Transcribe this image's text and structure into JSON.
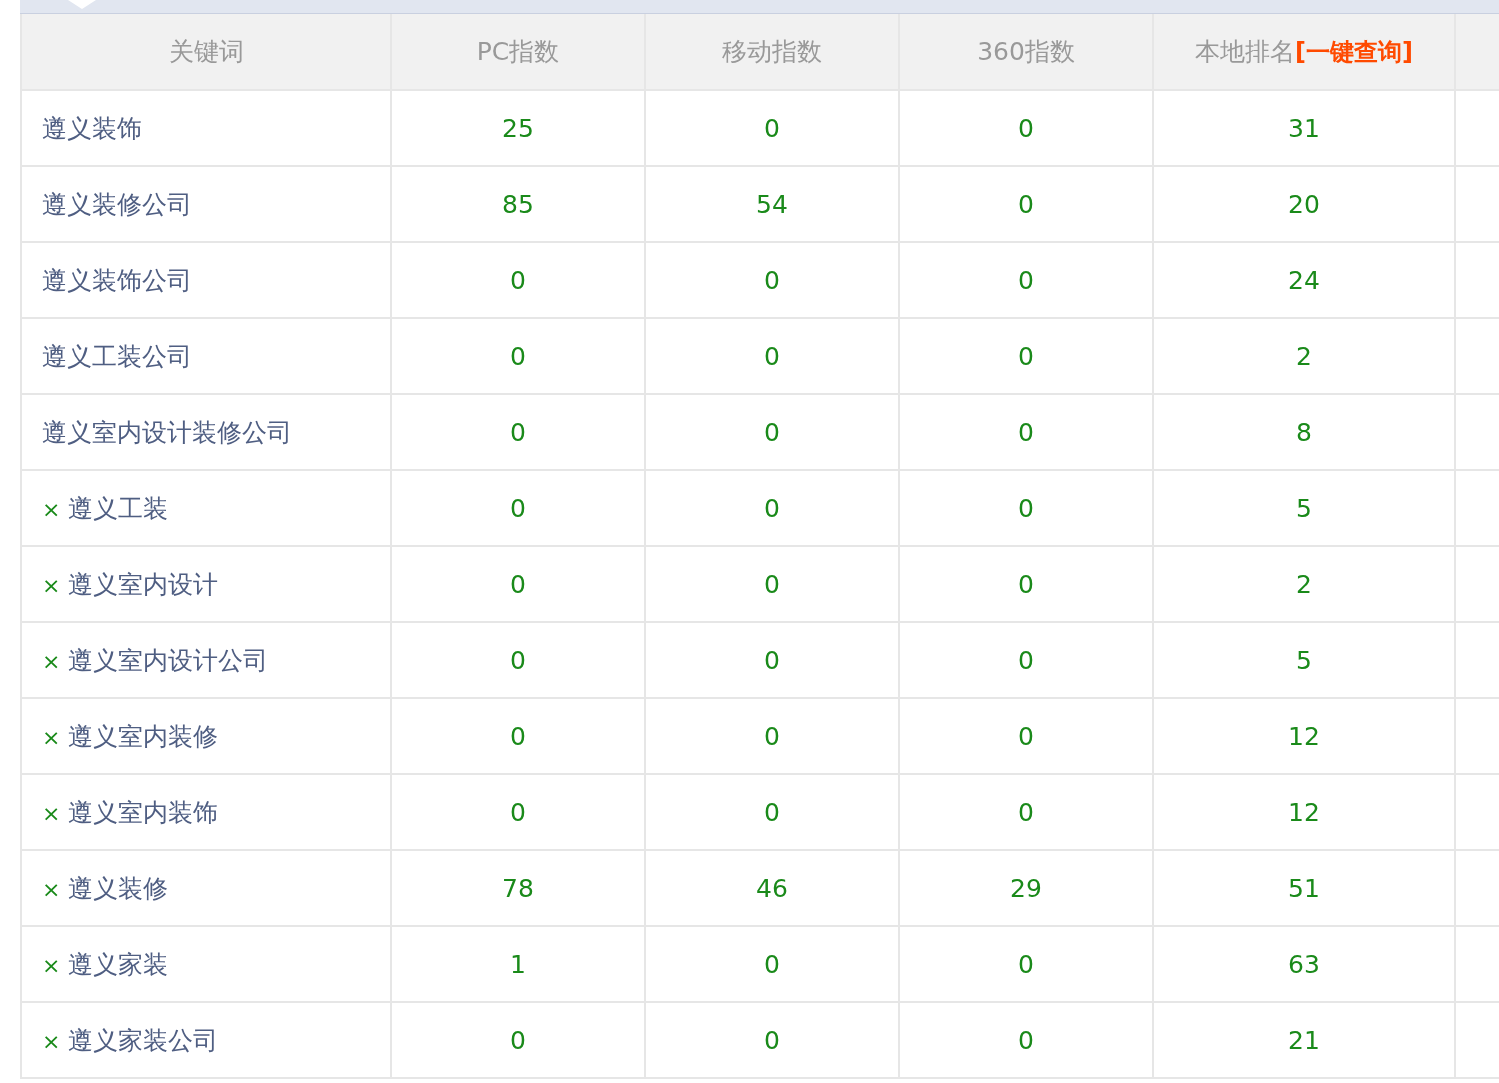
{
  "table": {
    "columns": [
      {
        "label": "关键词"
      },
      {
        "label": "PC指数"
      },
      {
        "label": "移动指数"
      },
      {
        "label": "360指数"
      },
      {
        "label": "本地排名",
        "link": "[一键查询]"
      }
    ],
    "rows": [
      {
        "keyword": "遵义装饰",
        "pc": "25",
        "mobile": "0",
        "i360": "0",
        "rank": "31"
      },
      {
        "keyword": "遵义装修公司",
        "pc": "85",
        "mobile": "54",
        "i360": "0",
        "rank": "20"
      },
      {
        "keyword": "遵义装饰公司",
        "pc": "0",
        "mobile": "0",
        "i360": "0",
        "rank": "24"
      },
      {
        "keyword": "遵义工装公司",
        "pc": "0",
        "mobile": "0",
        "i360": "0",
        "rank": "2"
      },
      {
        "keyword": "遵义室内设计装修公司",
        "pc": "0",
        "mobile": "0",
        "i360": "0",
        "rank": "8"
      },
      {
        "remove": "×",
        "keyword": "遵义工装",
        "pc": "0",
        "mobile": "0",
        "i360": "0",
        "rank": "5"
      },
      {
        "remove": "×",
        "keyword": "遵义室内设计",
        "pc": "0",
        "mobile": "0",
        "i360": "0",
        "rank": "2"
      },
      {
        "remove": "×",
        "keyword": "遵义室内设计公司",
        "pc": "0",
        "mobile": "0",
        "i360": "0",
        "rank": "5"
      },
      {
        "remove": "×",
        "keyword": "遵义室内装修",
        "pc": "0",
        "mobile": "0",
        "i360": "0",
        "rank": "12"
      },
      {
        "remove": "×",
        "keyword": "遵义室内装饰",
        "pc": "0",
        "mobile": "0",
        "i360": "0",
        "rank": "12"
      },
      {
        "remove": "×",
        "keyword": "遵义装修",
        "pc": "78",
        "mobile": "46",
        "i360": "29",
        "rank": "51"
      },
      {
        "remove": "×",
        "keyword": "遵义家装",
        "pc": "1",
        "mobile": "0",
        "i360": "0",
        "rank": "63"
      },
      {
        "remove": "×",
        "keyword": "遵义家装公司",
        "pc": "0",
        "mobile": "0",
        "i360": "0",
        "rank": "21"
      }
    ]
  }
}
